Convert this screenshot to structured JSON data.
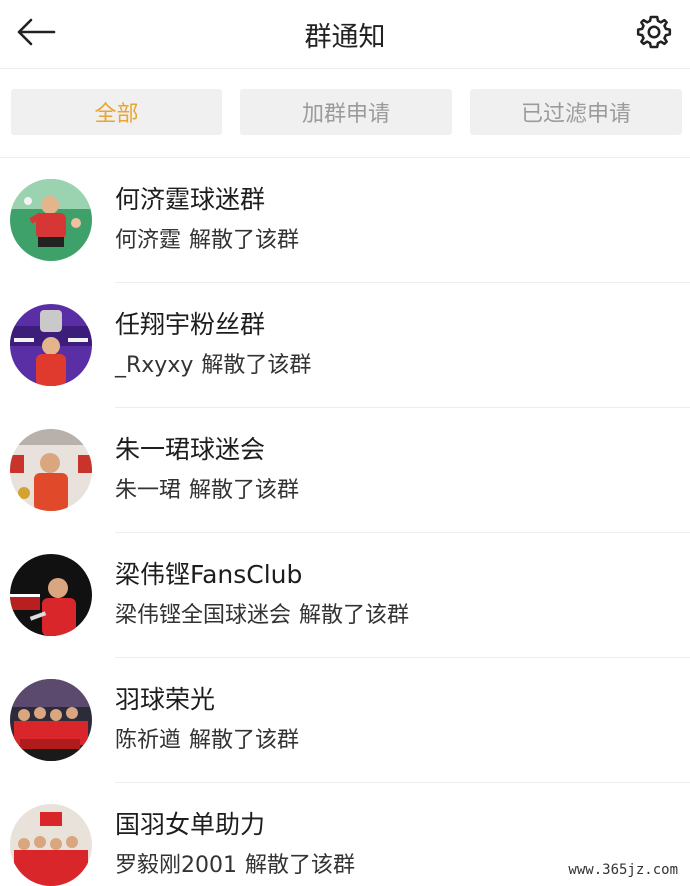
{
  "header": {
    "title": "群通知",
    "back_icon": "arrow-left-icon",
    "settings_icon": "gear-icon"
  },
  "tabs": [
    {
      "label": "全部",
      "active": true
    },
    {
      "label": "加群申请",
      "active": false
    },
    {
      "label": "已过滤申请",
      "active": false
    }
  ],
  "notifications": [
    {
      "group": "何济霆球迷群",
      "actor": "何济霆",
      "action": "解散了该群"
    },
    {
      "group": "任翔宇粉丝群",
      "actor": "_Rxyxy",
      "action": "解散了该群"
    },
    {
      "group": "朱一珺球迷会",
      "actor": "朱一珺",
      "action": "解散了该群"
    },
    {
      "group": "梁伟铿FansClub",
      "actor": "梁伟铿全国球迷会",
      "action": "解散了该群"
    },
    {
      "group": "羽球荣光",
      "actor": "陈祈遒",
      "action": "解散了该群"
    },
    {
      "group": "国羽女单助力",
      "actor": "罗毅刚2001",
      "action": "解散了该群"
    }
  ],
  "watermark": "www.365jz.com",
  "colors": {
    "accent": "#e8a530",
    "tab_bg": "#f0f0f0",
    "tab_inactive_text": "#9b9b9b",
    "divider": "#ededed"
  }
}
